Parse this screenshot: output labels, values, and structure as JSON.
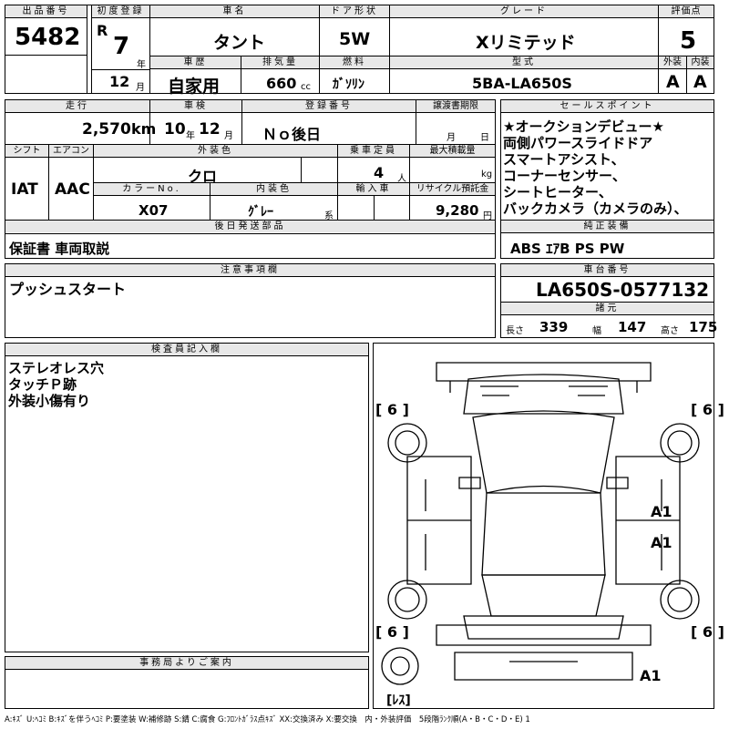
{
  "header": {
    "lot_label": "出品番号",
    "lot_number": "5482",
    "reg_label": "初度登録",
    "era": "R",
    "year": "7",
    "year_unit": "年",
    "month": "12",
    "month_unit": "月",
    "name_label": "車名",
    "car_name": "タント",
    "door_label": "ドア形状",
    "door": "5W",
    "grade_label": "グレード",
    "grade": "Xリミテッド",
    "score_label": "評価点",
    "score": "5",
    "history_label": "車歴",
    "history": "自家用",
    "disp_label": "排気量",
    "displacement": "660",
    "disp_unit": "cc",
    "fuel_label": "燃料",
    "fuel": "ｶﾞｿﾘﾝ",
    "model_label": "型式",
    "model": "5BA-LA650S",
    "ext_label": "外装",
    "ext_grade": "A",
    "int_label": "内装",
    "int_grade": "A"
  },
  "row2": {
    "mileage_label": "走行",
    "mileage": "2,570",
    "mileage_unit": "km",
    "inspection_label": "車検",
    "insp_year": "10",
    "insp_year_unit": "年",
    "insp_month": "12",
    "insp_month_unit": "月",
    "plate_label": "登録番号",
    "plate": "Ｎｏ後日",
    "transfer_label": "譲渡書期限",
    "transfer_month": "月",
    "transfer_day": "日"
  },
  "row3": {
    "shift_label": "シフト",
    "shift": "IAT",
    "ac_label": "エアコン",
    "ac": "AAC",
    "ext_color_label": "外装色",
    "ext_color": "クロ",
    "capacity_label": "乗車定員",
    "capacity": "4",
    "capacity_unit": "人",
    "load_label": "最大積載量",
    "load_unit": "kg",
    "color_no_label": "カラーNo.",
    "color_no": "X07",
    "int_color_label": "内装色",
    "int_color": "ｸﾞﾚｰ",
    "int_color_unit": "系",
    "import_label": "輸入車",
    "recycle_label": "リサイクル預託金",
    "recycle": "9,280",
    "recycle_unit": "円"
  },
  "sales_points": {
    "label": "セールスポイント",
    "lines": [
      "★オークションデビュー★",
      "両側パワースライドドア",
      "スマートアシスト、",
      "コーナーセンサー、",
      "シートヒーター、",
      "バックカメラ（カメラのみ）、"
    ]
  },
  "later_parts": {
    "label": "後日発送部品",
    "value": "保証書 車両取説"
  },
  "equipment": {
    "label": "純正装備",
    "value": "ABS ｴｱB PS PW"
  },
  "notes": {
    "label": "注意事項欄",
    "value": "プッシュスタート"
  },
  "chassis": {
    "label": "車台番号",
    "value": "LA650S-0577132",
    "dims_label": "諸元",
    "length_label": "長さ",
    "length": "339",
    "width_label": "幅",
    "width": "147",
    "height_label": "高さ",
    "height": "175"
  },
  "inspector": {
    "label": "検査員記入欄",
    "lines": [
      "ステレオレス穴",
      "タッチＰ跡",
      "外装小傷有り"
    ]
  },
  "office": {
    "label": "事務局よりご案内"
  },
  "diagram": {
    "tire_fl": "[ 6 ]",
    "tire_fr": "[ 6 ]",
    "tire_rl": "[ 6 ]",
    "tire_rr": "[ 6 ]",
    "mark_door1": "A1",
    "mark_door2": "A1",
    "mark_rear": "A1",
    "spare": "[ﾚｽ]"
  },
  "legend": "A:ｷｽﾞ U:ﾍｺﾐ B:ｷｽﾞを伴うﾍｺﾐ P:要塗装 W:補修跡 S:錆 C:腐食 G:ﾌﾛﾝﾄｶﾞﾗｽ点ｷｽﾞ XX:交換済み X:要交換　内・外装評価　5段階ﾗﾝｸ順(A・B・C・D・E) 1"
}
